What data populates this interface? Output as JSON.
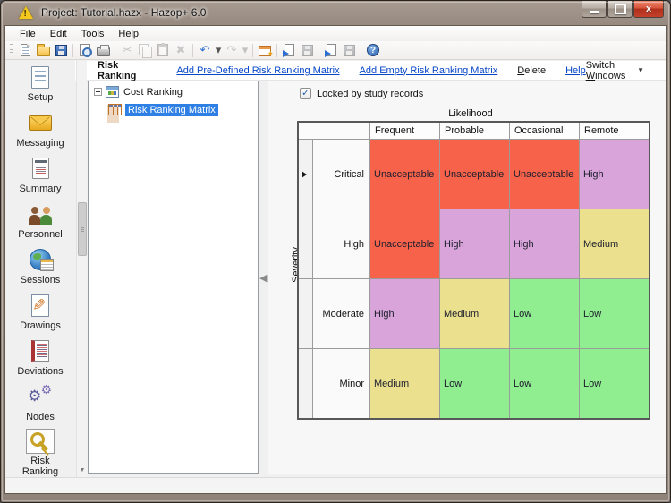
{
  "window": {
    "title": "Project: Tutorial.hazx - Hazop+ 6.0",
    "menu": [
      "File",
      "Edit",
      "Tools",
      "Help"
    ],
    "caption_buttons": [
      "minimize",
      "maximize",
      "close"
    ]
  },
  "toolbar": {
    "items": [
      {
        "name": "new-file-icon",
        "kind": "page",
        "enabled": true
      },
      {
        "name": "open-folder-icon",
        "kind": "folder",
        "enabled": true
      },
      {
        "name": "save-icon",
        "kind": "floppy",
        "enabled": true
      },
      {
        "name": "separator"
      },
      {
        "name": "print-preview-icon",
        "kind": "preview",
        "enabled": true
      },
      {
        "name": "print-icon",
        "kind": "printer",
        "enabled": true
      },
      {
        "name": "separator"
      },
      {
        "name": "cut-icon",
        "kind": "glyph",
        "glyph": "✂",
        "color": "#777",
        "enabled": false
      },
      {
        "name": "copy-icon",
        "kind": "copy",
        "enabled": false
      },
      {
        "name": "paste-icon",
        "kind": "clipboard",
        "enabled": false
      },
      {
        "name": "delete-icon",
        "kind": "glyph",
        "glyph": "✖",
        "color": "#888",
        "enabled": false
      },
      {
        "name": "separator"
      },
      {
        "name": "undo-icon",
        "kind": "glyph",
        "glyph": "↶",
        "color": "#2d6fd0",
        "enabled": true
      },
      {
        "name": "undo-dropdown-icon",
        "kind": "glyph",
        "glyph": "▾",
        "color": "#555",
        "enabled": true,
        "narrow": true
      },
      {
        "name": "redo-icon",
        "kind": "glyph",
        "glyph": "↷",
        "color": "#777",
        "enabled": false
      },
      {
        "name": "redo-dropdown-icon",
        "kind": "glyph",
        "glyph": "▾",
        "color": "#777",
        "enabled": false,
        "narrow": true
      },
      {
        "name": "separator"
      },
      {
        "name": "export-matrix-icon",
        "kind": "winstar",
        "enabled": true
      },
      {
        "name": "separator"
      },
      {
        "name": "open-study-icon",
        "kind": "pagearrow",
        "enabled": true
      },
      {
        "name": "save-study-icon",
        "kind": "floppy",
        "enabled": false
      },
      {
        "name": "separator"
      },
      {
        "name": "open-report-icon",
        "kind": "pagearrow",
        "enabled": true
      },
      {
        "name": "save-report-icon",
        "kind": "floppy",
        "enabled": false
      },
      {
        "name": "separator"
      },
      {
        "name": "help-icon",
        "kind": "help",
        "enabled": true
      }
    ]
  },
  "header": {
    "title": "Risk Ranking",
    "links": [
      {
        "label": "Add Pre-Defined Risk Ranking Matrix",
        "style": "link"
      },
      {
        "label": "Add Empty Risk Ranking Matrix",
        "style": "link"
      },
      {
        "label": "Delete",
        "style": "text",
        "mnemonic": "D"
      },
      {
        "label": "Help",
        "style": "link"
      }
    ],
    "switch_windows": "Switch Windows",
    "switch_windows_mnemonic": "W"
  },
  "sidebar": {
    "items": [
      {
        "label": "Setup",
        "icon": "setup-document-icon",
        "selected": false
      },
      {
        "label": "Messaging",
        "icon": "envelope-icon",
        "selected": false
      },
      {
        "label": "Summary",
        "icon": "report-icon",
        "selected": false
      },
      {
        "label": "Personnel",
        "icon": "people-icon",
        "selected": false
      },
      {
        "label": "Sessions",
        "icon": "globe-calendar-icon",
        "selected": false
      },
      {
        "label": "Drawings",
        "icon": "drawing-pencil-icon",
        "selected": false
      },
      {
        "label": "Deviations",
        "icon": "notebook-icon",
        "selected": false
      },
      {
        "label": "Nodes",
        "icon": "gears-icon",
        "selected": false
      },
      {
        "label": "Risk Ranking",
        "icon": "keys-icon",
        "selected": true
      }
    ]
  },
  "tree": {
    "root_label": "Cost Ranking",
    "root_expanded": true,
    "child_label": "Risk Ranking Matrix",
    "child_selected": true
  },
  "panel": {
    "locked_checkbox_label": "Locked by study records",
    "locked_checkbox_checked": true,
    "likelihood_label": "Likelihood",
    "severity_label": "Severity"
  },
  "risk_matrix": {
    "type": "table",
    "likelihood_columns": [
      "Frequent",
      "Probable",
      "Occasional",
      "Remote"
    ],
    "severity_rows": [
      "Critical",
      "High",
      "Moderate",
      "Minor"
    ],
    "cells": [
      [
        "Unacceptable",
        "Unacceptable",
        "Unacceptable",
        "High"
      ],
      [
        "Unacceptable",
        "High",
        "High",
        "Medium"
      ],
      [
        "High",
        "Medium",
        "Low",
        "Low"
      ],
      [
        "Medium",
        "Low",
        "Low",
        "Low"
      ]
    ],
    "value_colors": {
      "Unacceptable": "#f7624a",
      "High": "#d8a4da",
      "Medium": "#eae08e",
      "Low": "#90ee90"
    },
    "selected_row_index": 0
  }
}
